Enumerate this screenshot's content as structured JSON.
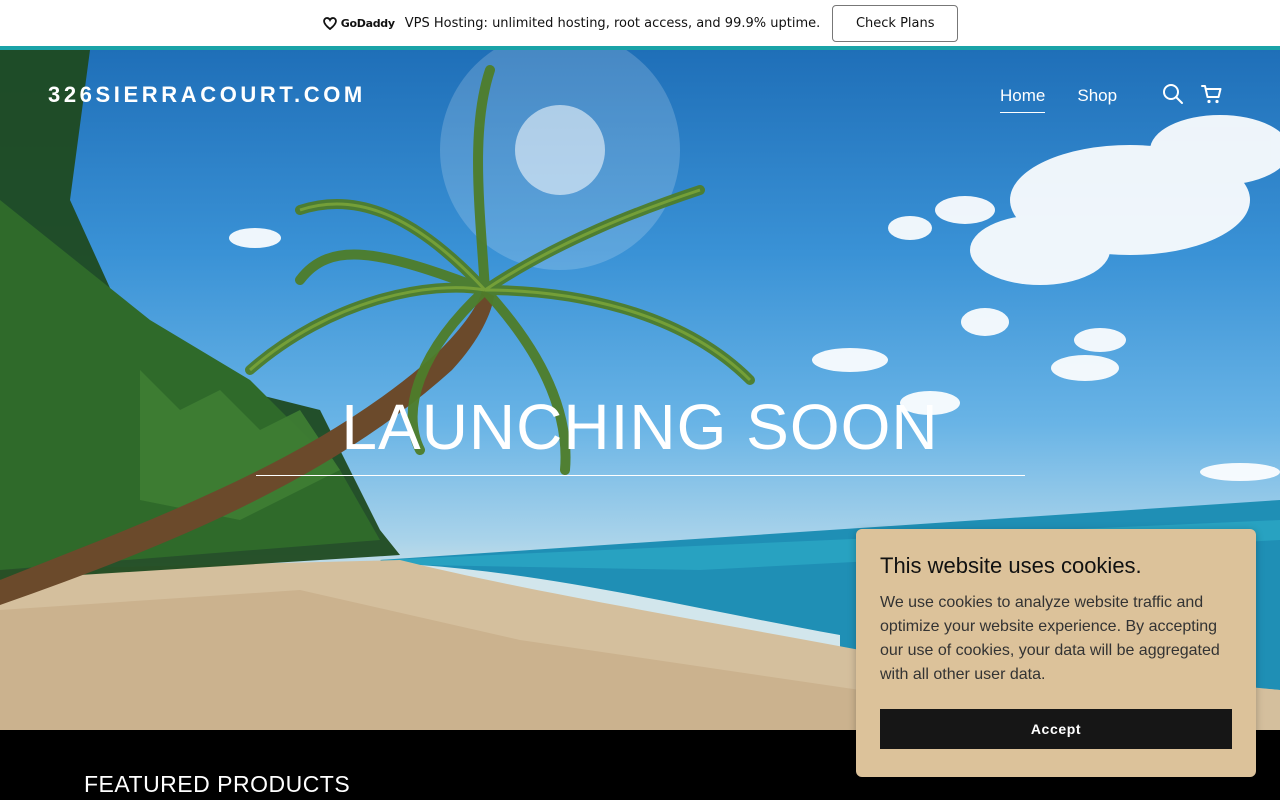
{
  "promo": {
    "logo_text": "GoDaddy",
    "message": "VPS Hosting: unlimited hosting, root access, and 99.9% uptime.",
    "button_label": "Check Plans"
  },
  "header": {
    "site_title": "326SIERRACOURT.COM",
    "nav": [
      {
        "label": "Home",
        "active": true
      },
      {
        "label": "Shop",
        "active": false
      }
    ],
    "icons": [
      "search-icon",
      "cart-icon"
    ]
  },
  "hero": {
    "title": "LAUNCHING SOON"
  },
  "featured": {
    "heading": "FEATURED PRODUCTS"
  },
  "cookie_banner": {
    "title": "This website uses cookies.",
    "body": "We use cookies to analyze website traffic and optimize your website experience. By accepting our use of cookies, your data will be aggregated with all other user data.",
    "accept_label": "Accept"
  },
  "colors": {
    "accent": "#1aa3a8",
    "cookie_bg": "#dcc29a",
    "button_dark": "#161616"
  }
}
